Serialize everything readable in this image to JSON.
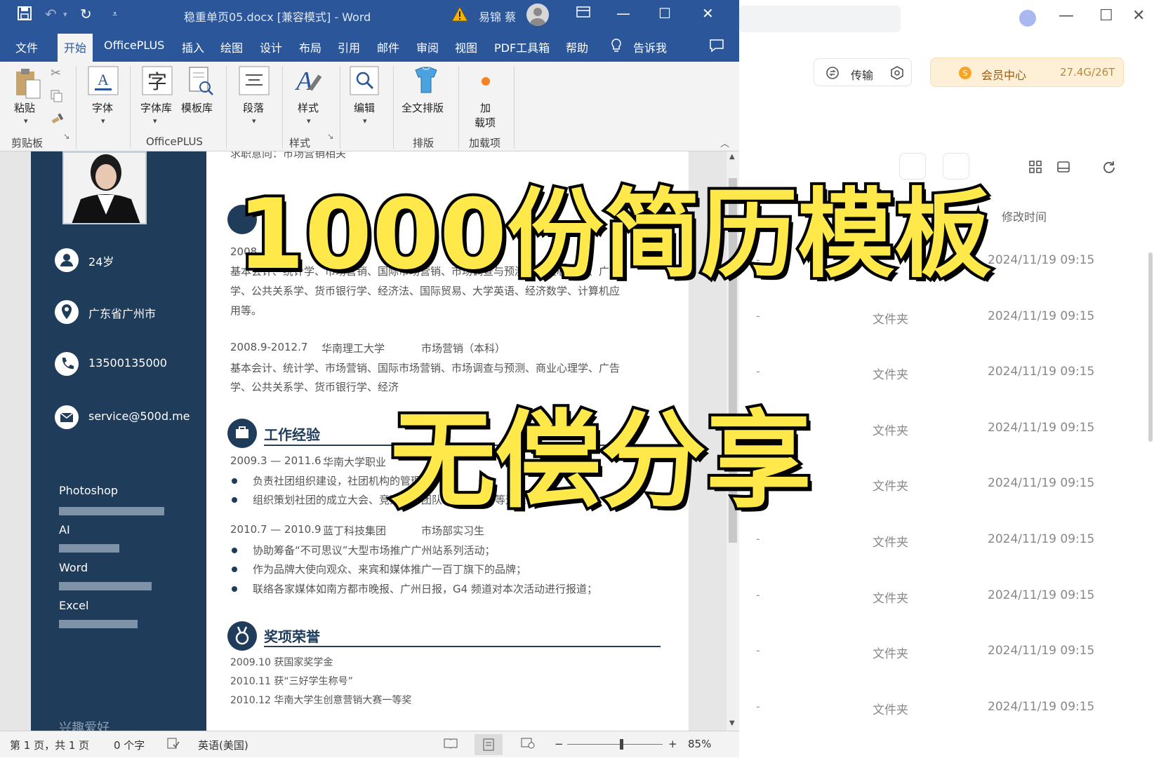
{
  "word": {
    "doc_title": "稳重单页05.docx [兼容模式] - Word",
    "user_name": "易锦 蔡",
    "tabs": [
      "文件",
      "开始",
      "OfficePLUS",
      "插入",
      "绘图",
      "设计",
      "布局",
      "引用",
      "邮件",
      "审阅",
      "视图",
      "PDF工具箱",
      "帮助",
      "告诉我"
    ],
    "active_tab": "开始",
    "ribbon": {
      "paste": "粘贴",
      "font": "字体",
      "font_lib": "字体库",
      "template_lib": "模板库",
      "paragraph": "段落",
      "styles": "样式",
      "edit": "编辑",
      "full_layout": "全文排版",
      "addin_line1": "加",
      "addin_line2": "载项",
      "groups": {
        "clipboard": "剪贴板",
        "officeplus": "OfficePLUS",
        "styles": "样式",
        "layout": "排版",
        "addins": "加载项"
      }
    },
    "resume": {
      "top_cut": "求职意向：市场营销相关",
      "sidebar": {
        "age": "24岁",
        "location": "广东省广州市",
        "phone": "13500135000",
        "email": "service@500d.me",
        "skills": [
          {
            "name": "Photoshop",
            "level": 0.75
          },
          {
            "name": "AI",
            "level": 0.43
          },
          {
            "name": "Word",
            "level": 0.66
          },
          {
            "name": "Excel",
            "level": 0.56
          }
        ],
        "partial": "兴趣爱好"
      },
      "education": {
        "line1_date": "2008",
        "line2": "基本会计、统计学、市场营销、国际市场营销、市场调查与预测、商业心理学、广",
        "line3": "学、公共关系学、货币银行学、经济法、国际贸易、大学英语、经济数学、计算机应",
        "line4": "用等。",
        "entry2_date": "2008.9-2012.7",
        "entry2_school": "华南理工大学",
        "entry2_major": "市场营销（本科）",
        "entry2_line1": "基本会计、统计学、市场营销、国际市场营销、市场调查与预测、商业心理学、广告",
        "entry2_line2": "学、公共关系学、货币银行学、经济"
      },
      "work": {
        "heading": "工作经验",
        "job1_date": "2009.3 — 2011.6",
        "job1_org": "华南大学职业",
        "job1_items": [
          "负责社团组织建设，社团机构的管理，",
          "组织策划社团的成立大会、竞选会、团队培训、招新等运维活动."
        ],
        "job2_date": "2010.7 — 2010.9",
        "job2_org": "蓝丁科技集团",
        "job2_role": "市场部实习生",
        "job2_items": [
          "协助筹备“不可思议”大型市场推广广州站系列活动；",
          "作为品牌大使向观众、来宾和媒体推广一百丁旗下的品牌；",
          "联络各家媒体如南方都市晚报、广州日报，G4 频道对本次活动进行报道；"
        ]
      },
      "awards": {
        "heading": "奖项荣誉",
        "items": [
          "2009.10 获国家奖学金",
          "2010.11 获“三好学生称号”",
          "2010.12 华南大学生创意营销大赛一等奖"
        ]
      }
    },
    "status": {
      "page": "第 1 页，共 1 页",
      "words": "0 个字",
      "language": "英语(美国)",
      "zoom": "85%",
      "zoom_level": 0.55
    }
  },
  "file_manager": {
    "transfer": "传输",
    "member_center": "会员中心",
    "quota": "27.4G/26T",
    "column_modified": "修改时间",
    "rows": [
      {
        "name": "-",
        "type": "",
        "modified": "2024/11/19 09:15"
      },
      {
        "name": "-",
        "type": "文件夹",
        "modified": "2024/11/19 09:15"
      },
      {
        "name": "-",
        "type": "文件夹",
        "modified": "2024/11/19 09:15"
      },
      {
        "name": "-",
        "type": "文件夹",
        "modified": "2024/11/19 09:15"
      },
      {
        "name": "-",
        "type": "文件夹",
        "modified": "2024/11/19 09:15"
      },
      {
        "name": "-",
        "type": "文件夹",
        "modified": "2024/11/19 09:15"
      },
      {
        "name": "-",
        "type": "文件夹",
        "modified": "2024/11/19 09:15"
      },
      {
        "name": "-",
        "type": "文件夹",
        "modified": "2024/11/19 09:15"
      },
      {
        "name": "-",
        "type": "文件夹",
        "modified": "2024/11/19 09:15"
      }
    ]
  },
  "overlay": {
    "headline": "1000份简历模板",
    "subline": "无偿分享"
  },
  "colors": {
    "word_blue": "#2b579a",
    "resume_navy": "#1f3c5b",
    "banner_yellow": "#ffe94a"
  }
}
